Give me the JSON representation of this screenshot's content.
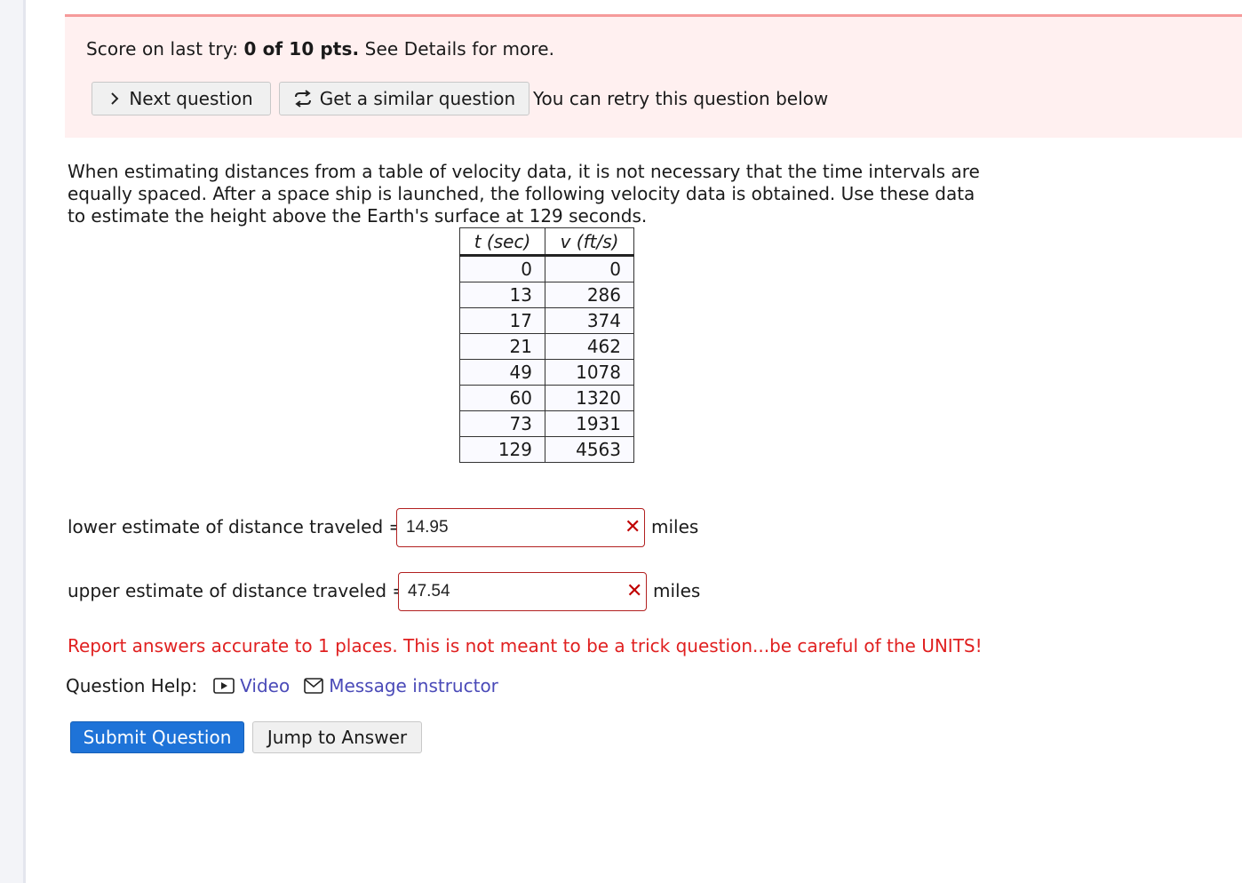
{
  "score": {
    "prefix": "Score on last try: ",
    "value": "0 of 10 pts.",
    "suffix": " See Details for more."
  },
  "buttons": {
    "next": "Next question",
    "similar": "Get a similar question",
    "retry_note": "You can retry this question below",
    "submit": "Submit Question",
    "jump": "Jump to Answer"
  },
  "question": {
    "prompt": "When estimating distances from a table of velocity data, it is not necessary that the time intervals are equally spaced. After a space ship is launched, the following velocity data is obtained. Use these data to estimate the height above the Earth's surface at 129 seconds.",
    "table": {
      "headers": [
        "t (sec)",
        "v (ft/s)"
      ],
      "rows": [
        [
          "0",
          "0"
        ],
        [
          "13",
          "286"
        ],
        [
          "17",
          "374"
        ],
        [
          "21",
          "462"
        ],
        [
          "49",
          "1078"
        ],
        [
          "60",
          "1320"
        ],
        [
          "73",
          "1931"
        ],
        [
          "129",
          "4563"
        ]
      ]
    },
    "lower": {
      "label": "lower estimate of distance traveled =",
      "value": "14.95",
      "unit": "miles"
    },
    "upper": {
      "label": "upper estimate of distance traveled =",
      "value": "47.54",
      "unit": "miles"
    },
    "note": "Report answers accurate to 1 places. This is not meant to be a trick question...be careful of the UNITS!"
  },
  "help": {
    "label": "Question Help:",
    "video": "Video",
    "message": "Message instructor"
  },
  "colors": {
    "error": "#c00000",
    "note_red": "#e02020",
    "link": "#4a4ab8",
    "submit": "#1e73d8",
    "panel_bg": "#fff0f0"
  }
}
